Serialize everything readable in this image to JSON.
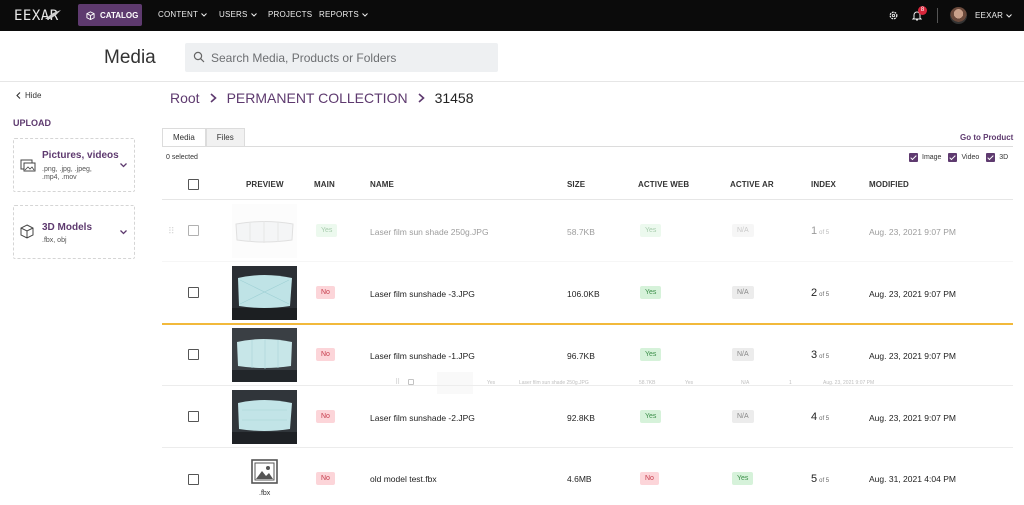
{
  "nav": {
    "logo": "EEXAR",
    "catalog": "CATALOG",
    "items": [
      "CONTENT",
      "USERS",
      "PROJECTS",
      "REPORTS"
    ],
    "notification_count": "8",
    "user_name": "EEXAR"
  },
  "header": {
    "title": "Media",
    "search_placeholder": "Search Media, Products or Folders"
  },
  "sidebar": {
    "hide": "Hide",
    "upload_title": "UPLOAD",
    "cards": [
      {
        "title": "Pictures, videos",
        "sub1": ".png, .jpg, .jpeg,",
        "sub2": ".mp4, .mov"
      },
      {
        "title": "3D Models",
        "sub1": ".fbx, obj",
        "sub2": ""
      }
    ]
  },
  "breadcrumb": [
    "Root",
    "PERMANENT COLLECTION",
    "31458"
  ],
  "tabs": [
    "Media",
    "Files"
  ],
  "goto_product": "Go to Product",
  "selected": "0 selected",
  "filters": [
    "Image",
    "Video",
    "3D"
  ],
  "columns": {
    "preview": "PREVIEW",
    "main": "MAIN",
    "name": "NAME",
    "size": "SIZE",
    "active_web": "ACTIVE WEB",
    "active_ar": "ACTIVE AR",
    "index": "INDEX",
    "modified": "MODIFIED"
  },
  "index_suffix": "of 5",
  "rows": [
    {
      "main": "Yes",
      "name": "Laser film sun shade 250g.JPG",
      "size": "58.7KB",
      "web": "Yes",
      "ar": "N/A",
      "index": "1",
      "modified": "Aug. 23, 2021 9:07 PM"
    },
    {
      "main": "No",
      "name": "Laser film sunshade -3.JPG",
      "size": "106.0KB",
      "web": "Yes",
      "ar": "N/A",
      "index": "2",
      "modified": "Aug. 23, 2021 9:07 PM"
    },
    {
      "main": "No",
      "name": "Laser film sunshade -1.JPG",
      "size": "96.7KB",
      "web": "Yes",
      "ar": "N/A",
      "index": "3",
      "modified": "Aug. 23, 2021 9:07 PM"
    },
    {
      "main": "No",
      "name": "Laser film sunshade -2.JPG",
      "size": "92.8KB",
      "web": "Yes",
      "ar": "N/A",
      "index": "4",
      "modified": "Aug. 23, 2021 9:07 PM"
    },
    {
      "main": "No",
      "name": "old model test.fbx",
      "size": "4.6MB",
      "web": "No",
      "ar": "Yes",
      "index": "5",
      "modified": "Aug. 31, 2021 4:04 PM",
      "file_label": ".fbx"
    }
  ],
  "ghost": {
    "main": "Yes",
    "name": "Laser film sun shade 250g.JPG",
    "size": "58.7KB",
    "web": "Yes",
    "ar": "N/A",
    "index": "1",
    "modified": "Aug. 23, 2021 9:07 PM"
  },
  "colors": {
    "nav_bg": "#0b0b0b",
    "accent": "#5e3a6f",
    "drop_indicator": "#f2b93b"
  }
}
